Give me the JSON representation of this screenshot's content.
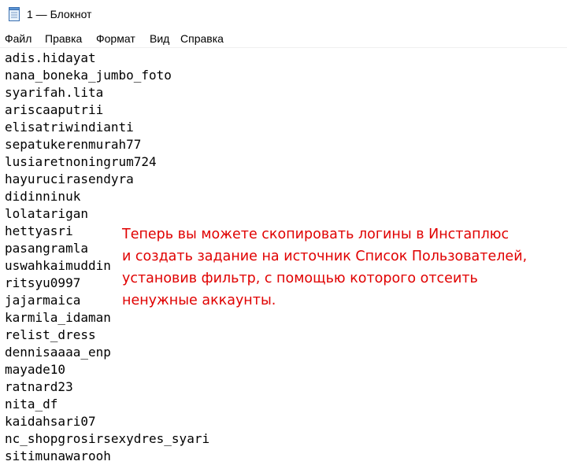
{
  "window": {
    "title": "1 — Блокнот",
    "icon": "notepad-icon"
  },
  "menu": {
    "file": "Файл",
    "edit": "Правка",
    "format": "Формат",
    "view": "Вид",
    "help": "Справка"
  },
  "document": {
    "lines": [
      "adis.hidayat",
      "nana_boneka_jumbo_foto",
      "syarifah.lita",
      "ariscaaputrii",
      "elisatriwindianti",
      "sepatukerenmurah77",
      "lusiaretnoningrum724",
      "hayurucirasendyra",
      "didinninuk",
      "lolatarigan",
      "hettyasri",
      "pasangramla",
      "uswahkaimuddin",
      "ritsyu0997",
      "jajarmaica",
      "karmila_idaman",
      "relist_dress",
      "dennisaaaa_enp",
      "mayade10",
      "ratnard23",
      "nita_df",
      "kaidahsari07",
      "nc_shopgrosirsexydres_syari",
      "sitimunawarooh"
    ]
  },
  "annotation": {
    "color": "#e00000",
    "lines": [
      "Теперь вы можете скопировать логины в Инстаплюс",
      "и создать задание на источник Список Пользователей,",
      "установив фильтр, с помощью которого отсеить",
      "ненужные аккаунты."
    ]
  }
}
